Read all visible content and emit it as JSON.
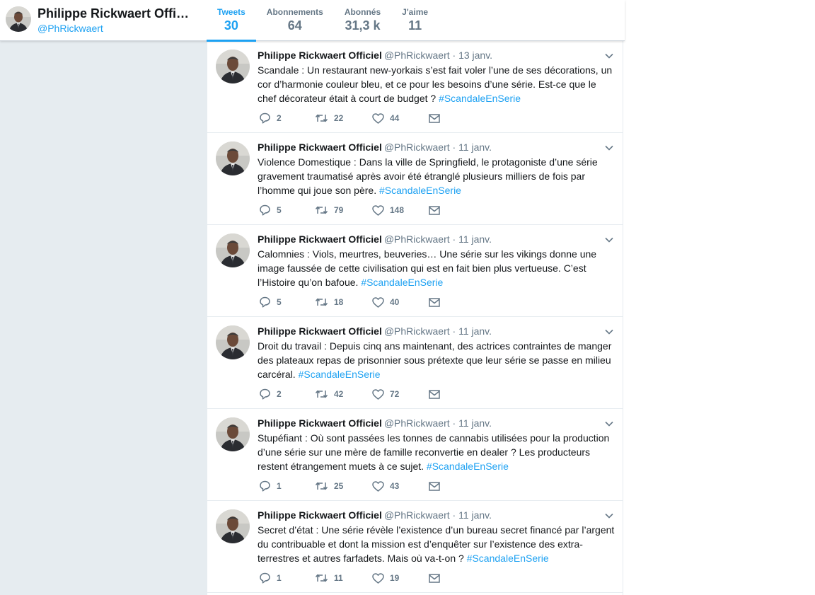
{
  "profile": {
    "name": "Philippe Rickwaert Officiel",
    "handle": "@PhRickwaert"
  },
  "stats": [
    {
      "label": "Tweets",
      "value": "30",
      "active": true
    },
    {
      "label": "Abonnements",
      "value": "64",
      "active": false
    },
    {
      "label": "Abonnés",
      "value": "31,3 k",
      "active": false
    },
    {
      "label": "J'aime",
      "value": "11",
      "active": false
    }
  ],
  "tweets": [
    {
      "name": "Philippe Rickwaert Officiel",
      "handle": "@PhRickwaert",
      "sep": " · ",
      "date": "13 janv.",
      "text": "Scandale : Un restaurant new-yorkais s’est fait voler l’une de ses décorations, un cor d’harmonie couleur bleu, et ce pour les besoins d’une série. Est-ce que le chef décorateur était à court de budget ? ",
      "hashtag": " #ScandaleEnSerie",
      "replies": "2",
      "retweets": "22",
      "likes": "44"
    },
    {
      "name": "Philippe Rickwaert Officiel",
      "handle": "@PhRickwaert",
      "sep": " · ",
      "date": "11 janv.",
      "text": "Violence Domestique : Dans la ville de Springfield, le protagoniste d’une série gravement traumatisé après avoir été étranglé plusieurs milliers de fois par l’homme qui joue son père. ",
      "hashtag": "#ScandaleEnSerie",
      "replies": "5",
      "retweets": "79",
      "likes": "148"
    },
    {
      "name": "Philippe Rickwaert Officiel",
      "handle": "@PhRickwaert",
      "sep": " · ",
      "date": "11 janv.",
      "text": "Calomnies : Viols, meurtres, beuveries… Une série sur les vikings donne une image faussée de cette civilisation qui est en fait bien plus vertueuse. C’est l’Histoire qu’on bafoue. ",
      "hashtag": "#ScandaleEnSerie",
      "replies": "5",
      "retweets": "18",
      "likes": "40"
    },
    {
      "name": "Philippe Rickwaert Officiel",
      "handle": "@PhRickwaert",
      "sep": " · ",
      "date": "11 janv.",
      "text": "Droit du travail : Depuis cinq ans maintenant, des actrices contraintes de manger des plateaux repas de prisonnier sous prétexte que leur série se passe en milieu carcéral. ",
      "hashtag": "#ScandaleEnSerie",
      "replies": "2",
      "retweets": "42",
      "likes": "72"
    },
    {
      "name": "Philippe Rickwaert Officiel",
      "handle": "@PhRickwaert",
      "sep": " · ",
      "date": "11 janv.",
      "text": "Stupéfiant : Où sont passées les tonnes de cannabis utilisées pour la production d’une série sur une mère de famille reconvertie en dealer ? Les producteurs restent étrangement muets à ce sujet. ",
      "hashtag": "#ScandaleEnSerie",
      "replies": "1",
      "retweets": "25",
      "likes": "43"
    },
    {
      "name": "Philippe Rickwaert Officiel",
      "handle": "@PhRickwaert",
      "sep": " · ",
      "date": "11 janv.",
      "text": "Secret d’état : Une série révèle l’existence d’un bureau secret financé par l’argent du contribuable et dont la mission est d’enquêter sur l’existence des extra-terrestres et autres farfadets. Mais où va-t-on ? ",
      "hashtag": "#ScandaleEnSerie",
      "replies": "1",
      "retweets": "11",
      "likes": "19"
    }
  ],
  "colors": {
    "accent": "#1da1f2",
    "muted": "#657786",
    "background": "#e6ecf0"
  }
}
